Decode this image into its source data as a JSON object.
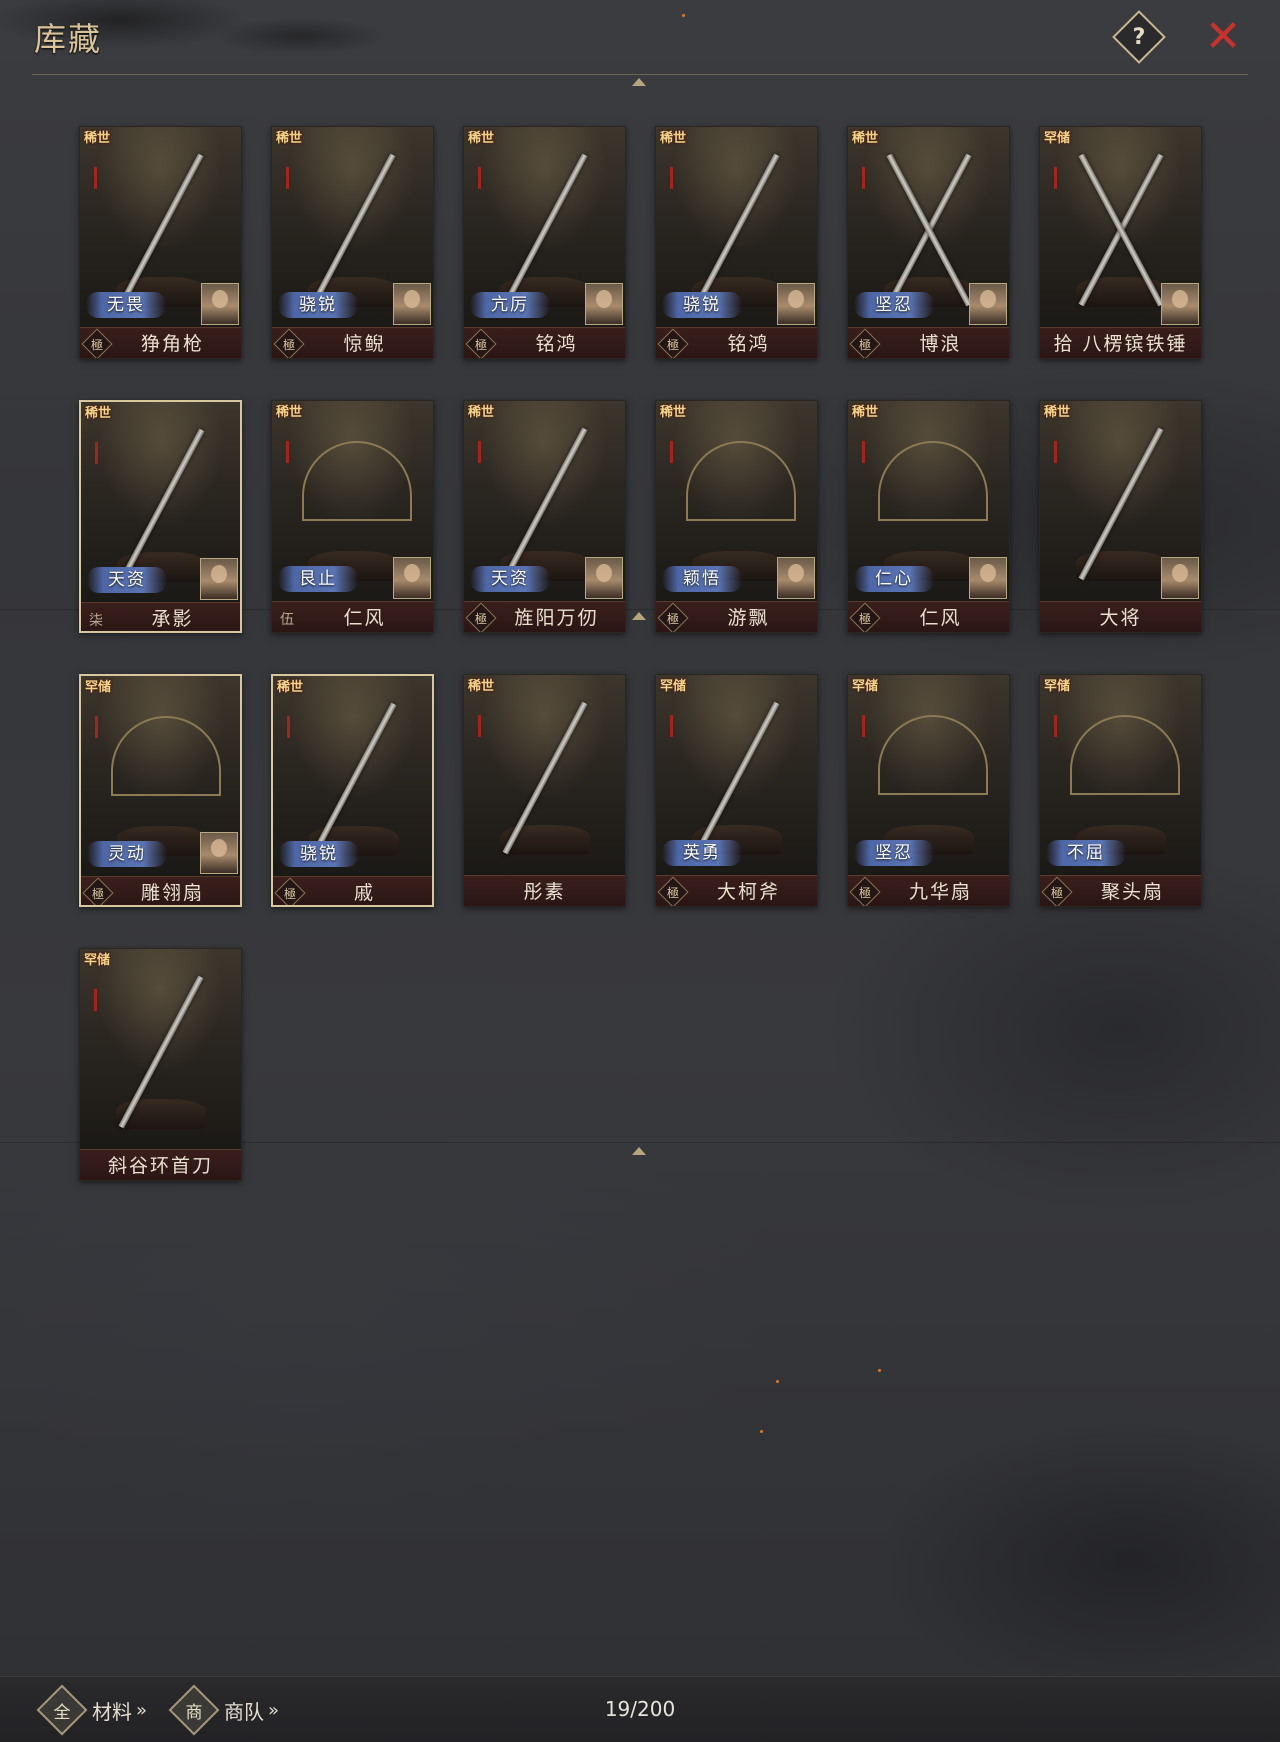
{
  "header": {
    "title": "库藏",
    "help_label": "?",
    "close_label": "✕"
  },
  "cards": [
    {
      "rarity": "稀世",
      "tag": "无畏",
      "grade": "極",
      "name": "狰角枪",
      "portrait": true,
      "selected": false,
      "art": "spear"
    },
    {
      "rarity": "稀世",
      "tag": "骁锐",
      "grade": "極",
      "name": "惊鲵",
      "portrait": true,
      "selected": false,
      "art": "spear"
    },
    {
      "rarity": "稀世",
      "tag": "亢厉",
      "grade": "極",
      "name": "铭鸿",
      "portrait": true,
      "selected": false,
      "art": "sword"
    },
    {
      "rarity": "稀世",
      "tag": "骁锐",
      "grade": "極",
      "name": "铭鸿",
      "portrait": true,
      "selected": false,
      "art": "sword"
    },
    {
      "rarity": "稀世",
      "tag": "坚忍",
      "grade": "極",
      "name": "博浪",
      "portrait": true,
      "selected": false,
      "art": "hammer"
    },
    {
      "rarity": "罕储",
      "tag": "",
      "grade": "",
      "name": "拾 八楞镔铁锤",
      "portrait": true,
      "selected": false,
      "art": "hammer"
    },
    {
      "rarity": "稀世",
      "tag": "天资",
      "grade": "柒",
      "name": "承影",
      "portrait": true,
      "selected": true,
      "art": "sword"
    },
    {
      "rarity": "稀世",
      "tag": "艮止",
      "grade": "伍",
      "name": "仁风",
      "portrait": true,
      "selected": false,
      "art": "fan"
    },
    {
      "rarity": "稀世",
      "tag": "天资",
      "grade": "極",
      "name": "旌阳万仞",
      "portrait": true,
      "selected": false,
      "art": "sword"
    },
    {
      "rarity": "稀世",
      "tag": "颖悟",
      "grade": "極",
      "name": "游飘",
      "portrait": true,
      "selected": false,
      "art": "fan"
    },
    {
      "rarity": "稀世",
      "tag": "仁心",
      "grade": "極",
      "name": "仁风",
      "portrait": true,
      "selected": false,
      "art": "fan"
    },
    {
      "rarity": "稀世",
      "tag": "",
      "grade": "",
      "name": "大将",
      "portrait": true,
      "selected": false,
      "art": "spear"
    },
    {
      "rarity": "罕储",
      "tag": "灵动",
      "grade": "極",
      "name": "雕翎扇",
      "portrait": true,
      "selected": true,
      "art": "fan"
    },
    {
      "rarity": "稀世",
      "tag": "骁锐",
      "grade": "極",
      "name": "戚",
      "portrait": false,
      "selected": true,
      "art": "axe"
    },
    {
      "rarity": "稀世",
      "tag": "",
      "grade": "",
      "name": "彤素",
      "portrait": false,
      "selected": false,
      "art": "bow"
    },
    {
      "rarity": "罕储",
      "tag": "英勇",
      "grade": "極",
      "name": "大柯斧",
      "portrait": false,
      "selected": false,
      "art": "axe"
    },
    {
      "rarity": "罕储",
      "tag": "坚忍",
      "grade": "極",
      "name": "九华扇",
      "portrait": false,
      "selected": false,
      "art": "fan"
    },
    {
      "rarity": "罕储",
      "tag": "不屈",
      "grade": "極",
      "name": "聚头扇",
      "portrait": false,
      "selected": false,
      "art": "fan"
    },
    {
      "rarity": "罕储",
      "tag": "",
      "grade": "",
      "name": "斜谷环首刀",
      "portrait": false,
      "selected": false,
      "art": "sword"
    }
  ],
  "footer": {
    "materials_icon": "全",
    "materials_label": "材料",
    "caravan_icon": "商",
    "caravan_label": "商队",
    "chevron": "»",
    "count": "19/200"
  }
}
